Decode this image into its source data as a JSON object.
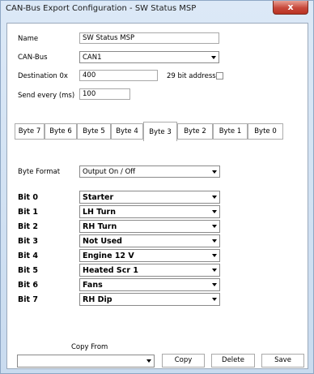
{
  "window": {
    "title": "CAN-Bus Export Configuration - SW Status MSP",
    "close_symbol": "x"
  },
  "form": {
    "name_label": "Name",
    "name_value": "SW Status MSP",
    "canbus_label": "CAN-Bus",
    "canbus_value": "CAN1",
    "dest_label": "Destination 0x",
    "dest_value": "400",
    "addr29_label": "29 bit address",
    "addr29_checked": false,
    "send_label": "Send every (ms)",
    "send_value": "100"
  },
  "tabs": [
    {
      "label": "Byte 7",
      "active": false
    },
    {
      "label": "Byte 6",
      "active": false
    },
    {
      "label": "Byte 5",
      "active": false
    },
    {
      "label": "Byte 4",
      "active": false
    },
    {
      "label": "Byte 3",
      "active": true
    },
    {
      "label": "Byte 2",
      "active": false
    },
    {
      "label": "Byte 1",
      "active": false
    },
    {
      "label": "Byte 0",
      "active": false
    }
  ],
  "byte_format": {
    "label": "Byte Format",
    "value": "Output On / Off"
  },
  "bits": [
    {
      "label": "Bit 0",
      "value": "Starter"
    },
    {
      "label": "Bit 1",
      "value": "LH Turn"
    },
    {
      "label": "Bit 2",
      "value": "RH Turn"
    },
    {
      "label": "Bit 3",
      "value": "Not Used"
    },
    {
      "label": "Bit 4",
      "value": "Engine 12 V"
    },
    {
      "label": "Bit 5",
      "value": "Heated Scr 1"
    },
    {
      "label": "Bit 6",
      "value": "Fans"
    },
    {
      "label": "Bit 7",
      "value": "RH Dip"
    }
  ],
  "footer": {
    "copy_from_label": "Copy From",
    "copy_from_value": "",
    "copy_label": "Copy",
    "delete_label": "Delete",
    "save_label": "Save"
  },
  "colors": {
    "titlebar": "#d6e5f5",
    "close_button": "#c7483a",
    "panel": "#ffffff"
  }
}
